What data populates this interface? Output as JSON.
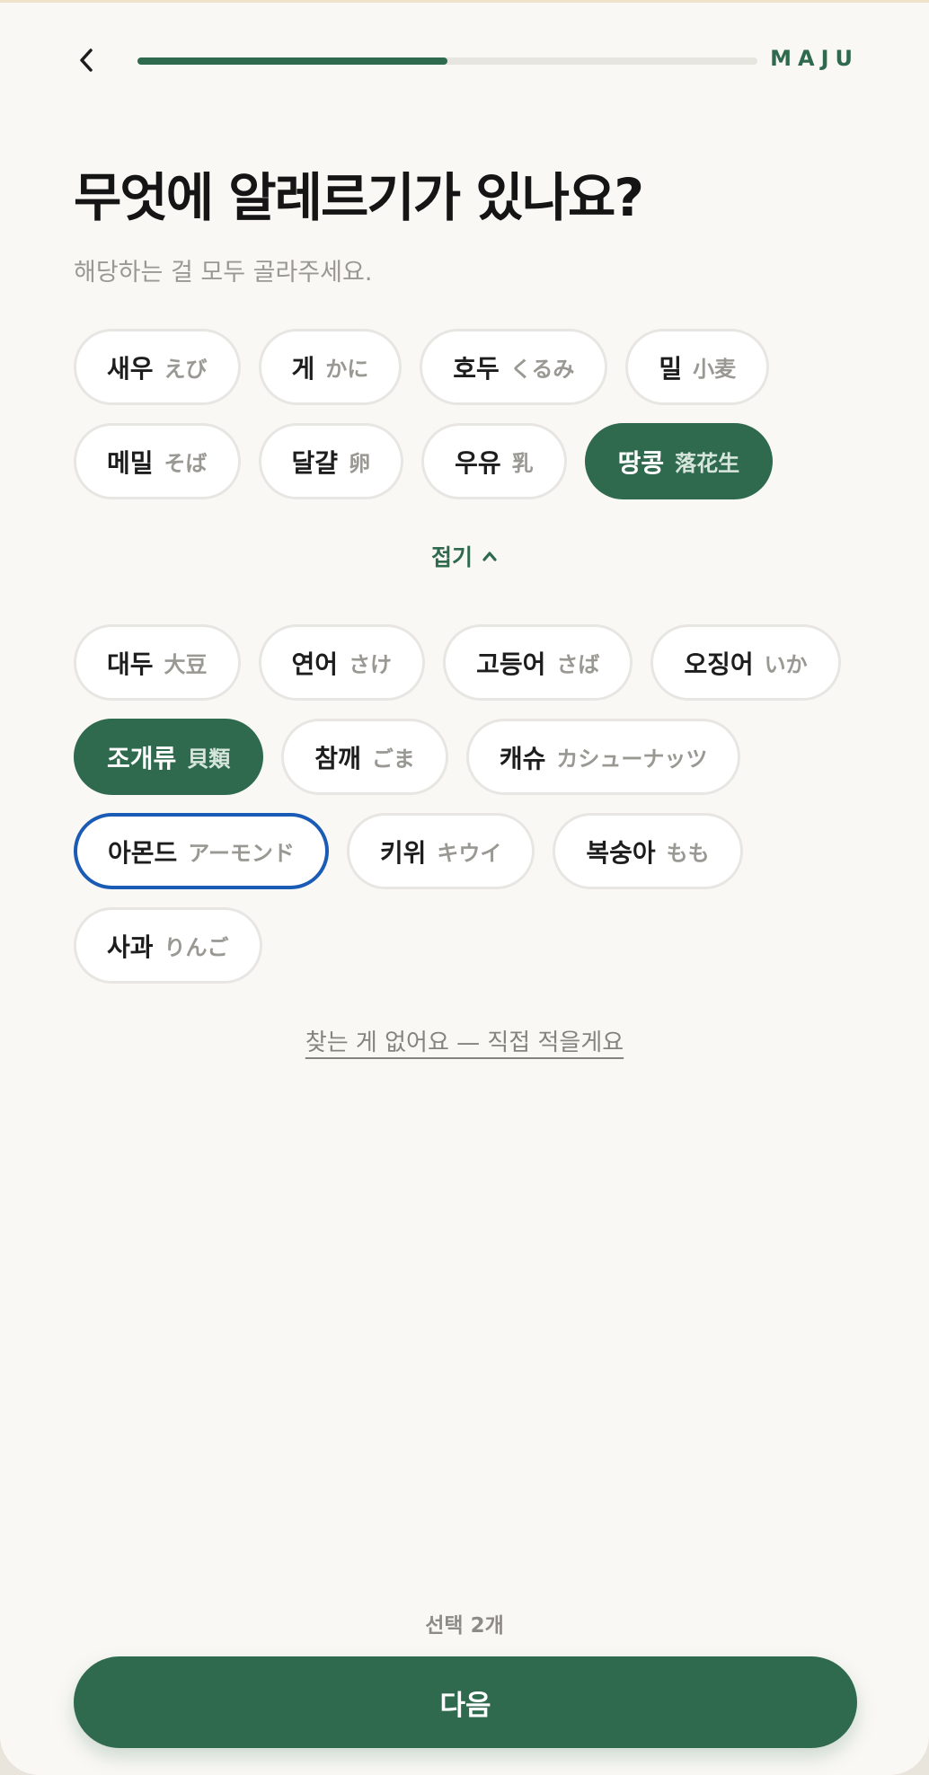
{
  "app": {
    "brand": "MAJU"
  },
  "progress": {
    "fraction": 0.5
  },
  "header": {
    "title": "무엇에 알레르기가 있나요?",
    "subtitle": "해당하는 걸 모두 골라주세요."
  },
  "allergens_primary": [
    {
      "ko": "새우",
      "jp": "えび",
      "selected": false
    },
    {
      "ko": "게",
      "jp": "かに",
      "selected": false
    },
    {
      "ko": "호두",
      "jp": "くるみ",
      "selected": false
    },
    {
      "ko": "밀",
      "jp": "小麦",
      "selected": false
    },
    {
      "ko": "메밀",
      "jp": "そば",
      "selected": false
    },
    {
      "ko": "달걀",
      "jp": "卵",
      "selected": false
    },
    {
      "ko": "우유",
      "jp": "乳",
      "selected": false
    },
    {
      "ko": "땅콩",
      "jp": "落花生",
      "selected": true
    }
  ],
  "collapse": {
    "label": "접기"
  },
  "allergens_more": [
    {
      "ko": "대두",
      "jp": "大豆",
      "selected": false
    },
    {
      "ko": "연어",
      "jp": "さけ",
      "selected": false
    },
    {
      "ko": "고등어",
      "jp": "さば",
      "selected": false
    },
    {
      "ko": "오징어",
      "jp": "いか",
      "selected": false
    },
    {
      "ko": "조개류",
      "jp": "貝類",
      "selected": true
    },
    {
      "ko": "참깨",
      "jp": "ごま",
      "selected": false
    },
    {
      "ko": "캐슈",
      "jp": "カシューナッツ",
      "selected": false
    },
    {
      "ko": "아몬드",
      "jp": "アーモンド",
      "selected": false,
      "focused": true
    },
    {
      "ko": "키위",
      "jp": "キウイ",
      "selected": false
    },
    {
      "ko": "복숭아",
      "jp": "もも",
      "selected": false
    },
    {
      "ko": "사과",
      "jp": "りんご",
      "selected": false
    }
  ],
  "manual_entry": {
    "label": "찾는 게 없어요 — 직접 적을게요"
  },
  "footer": {
    "selected_count": "선택 2개",
    "next_label": "다음"
  },
  "colors": {
    "accent": "#2f6a4e",
    "focus_ring": "#1a5bb5",
    "background": "#faf8f5"
  },
  "icons": {
    "back": "chevron-left-icon",
    "collapse": "chevron-up-icon"
  }
}
